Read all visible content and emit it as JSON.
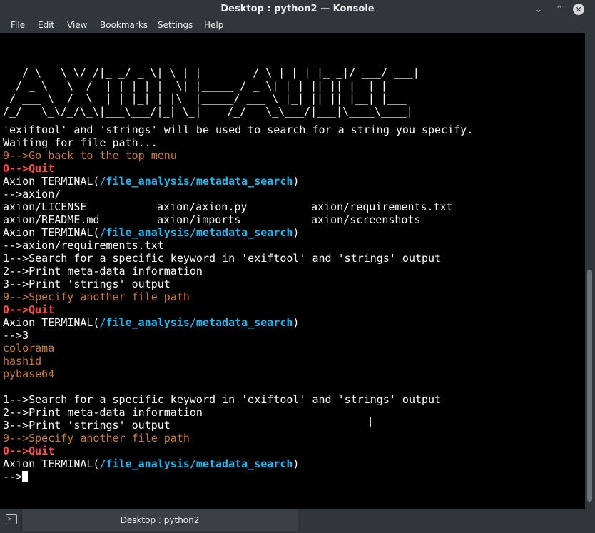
{
  "window": {
    "title": "Desktop : python2 — Konsole",
    "minimize_glyph": "⌄",
    "maximize_glyph": "⌃",
    "close_glyph": "✕"
  },
  "menu": [
    "File",
    "Edit",
    "View",
    "Bookmarks",
    "Settings",
    "Help"
  ],
  "banner": "    _    __  __ ___ ___  _   _          _   _   _ ___  ____ \n   / \\   \\ \\/ /|_ _/ _ \\| \\ | |        / \\ | | | |_ _|/ ___/ ___|\n  / _ \\   \\  /  | | | | |  \\| |_____ / _ \\| | | || || |  | |\n / ___ \\  /  \\  | | |_| | |\\  |_____/ ___ \\ |_| || || |__| |___\n/_/   \\_\\/_/\\_\\|___\\___/|_| \\_|    /_/   \\_\\___/|___|\\____\\____|",
  "terminal": {
    "info": "'exiftool' and 'strings' will be used to search for a string you specify.",
    "waiting": "Waiting for file path...",
    "back_top": "9-->Go back to the top menu",
    "quit": "0-->Quit",
    "prompt_prefix": "Axion TERMINAL(",
    "prompt_path": "/file_analysis/metadata_search",
    "prompt_suffix": ")",
    "input_1": "-->axion/",
    "listing": [
      [
        "axion/LICENSE",
        "axion/axion.py",
        "axion/requirements.txt"
      ],
      [
        "axion/README.md",
        "axion/imports",
        "axion/screenshots"
      ]
    ],
    "input_2": "-->axion/requirements.txt",
    "opt_1": "1-->Search for a specific keyword in 'exiftool' and 'strings' output",
    "opt_2": "2-->Print meta-data information",
    "opt_3": "3-->Print 'strings' output",
    "opt_9": "9-->Specify another file path",
    "input_3": "-->3",
    "strings_output": [
      "colorama",
      "hashid",
      "pybase64"
    ],
    "final_prompt": "-->"
  },
  "taskbar": {
    "tab_label": "Desktop : python2",
    "icon_glyph": ">_"
  }
}
